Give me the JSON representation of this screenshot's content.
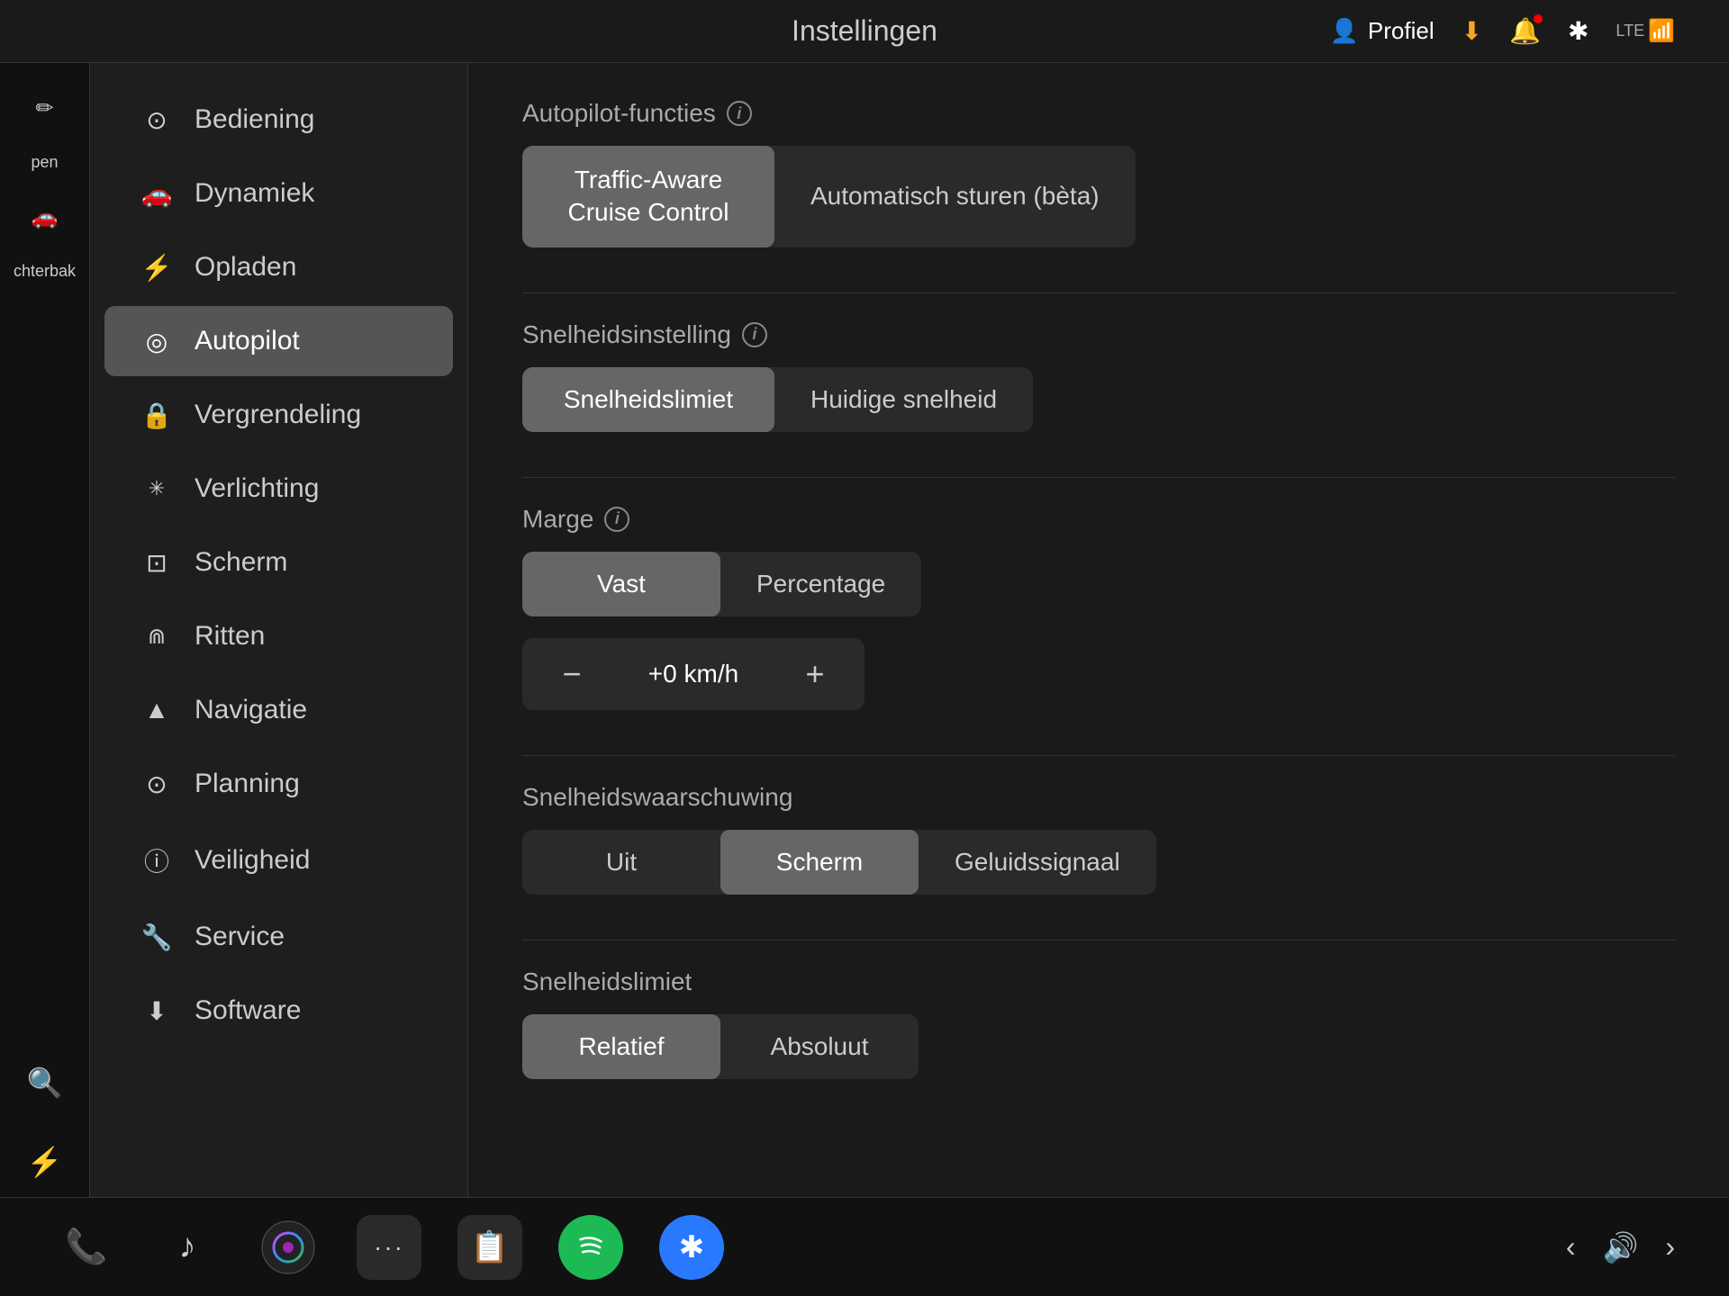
{
  "topbar": {
    "title": "Instellingen",
    "profile_label": "Profiel",
    "icons": {
      "profile": "👤",
      "download": "⬇",
      "bell": "🔔",
      "bluetooth": "✱",
      "signal": "📶"
    }
  },
  "left_edge": {
    "items": [
      {
        "icon": "pen",
        "label": "open",
        "active": false
      },
      {
        "icon": "trunk",
        "label": "chterbak",
        "active": false
      }
    ]
  },
  "sidebar": {
    "items": [
      {
        "id": "bediening",
        "label": "Bediening",
        "icon": "⊙"
      },
      {
        "id": "dynamiek",
        "label": "Dynamiek",
        "icon": "🚗"
      },
      {
        "id": "opladen",
        "label": "Opladen",
        "icon": "⚡"
      },
      {
        "id": "autopilot",
        "label": "Autopilot",
        "icon": "◎",
        "active": true
      },
      {
        "id": "vergrendeling",
        "label": "Vergrendeling",
        "icon": "🔒"
      },
      {
        "id": "verlichting",
        "label": "Verlichting",
        "icon": "✳"
      },
      {
        "id": "scherm",
        "label": "Scherm",
        "icon": "⊡"
      },
      {
        "id": "ritten",
        "label": "Ritten",
        "icon": "⋒"
      },
      {
        "id": "navigatie",
        "label": "Navigatie",
        "icon": "▲"
      },
      {
        "id": "planning",
        "label": "Planning",
        "icon": "⊙"
      },
      {
        "id": "veiligheid",
        "label": "Veiligheid",
        "icon": "ⓘ"
      },
      {
        "id": "service",
        "label": "Service",
        "icon": "🔧"
      },
      {
        "id": "software",
        "label": "Software",
        "icon": "⬇"
      }
    ]
  },
  "main": {
    "sections": {
      "autopilot_functions": {
        "title": "Autopilot-functies",
        "info": "i",
        "options": [
          {
            "id": "tacc",
            "label": "Traffic-Aware\nCruise Control",
            "active": true
          },
          {
            "id": "autosteer",
            "label": "Automatisch sturen (bèta)",
            "active": false
          }
        ]
      },
      "speed_setting": {
        "title": "Snelheidsinstelling",
        "info": "i",
        "options": [
          {
            "id": "speed_limit",
            "label": "Snelheidslimiet",
            "active": true
          },
          {
            "id": "current_speed",
            "label": "Huidige snelheid",
            "active": false
          }
        ]
      },
      "margin": {
        "title": "Marge",
        "info": "i",
        "options": [
          {
            "id": "fixed",
            "label": "Vast",
            "active": true
          },
          {
            "id": "percentage",
            "label": "Percentage",
            "active": false
          }
        ],
        "speed_control": {
          "decrement": "−",
          "value": "+0 km/h",
          "increment": "+"
        }
      },
      "speed_warning": {
        "title": "Snelheidswaarschuwing",
        "options": [
          {
            "id": "off",
            "label": "Uit",
            "active": false
          },
          {
            "id": "screen",
            "label": "Scherm",
            "active": true
          },
          {
            "id": "sound",
            "label": "Geluidssignaal",
            "active": false
          }
        ]
      },
      "speed_limit": {
        "title": "Snelheidslimiet",
        "options": [
          {
            "id": "relative",
            "label": "Relatief",
            "active": true
          },
          {
            "id": "absolute",
            "label": "Absoluut",
            "active": false
          }
        ]
      }
    }
  },
  "taskbar": {
    "items": [
      {
        "id": "phone",
        "label": "📞",
        "color": "green"
      },
      {
        "id": "music",
        "label": "♪",
        "color": "white"
      },
      {
        "id": "siri",
        "label": "🎙",
        "color": "purple"
      },
      {
        "id": "more",
        "label": "···",
        "color": "gray"
      },
      {
        "id": "notes",
        "label": "📋",
        "color": "gray"
      },
      {
        "id": "spotify",
        "label": "Spotify",
        "color": "green",
        "type": "spotify"
      },
      {
        "id": "bluetooth",
        "label": "✱",
        "color": "blue",
        "type": "bluetooth"
      }
    ],
    "nav": {
      "prev": "‹",
      "next": "›",
      "volume": "🔊"
    }
  }
}
